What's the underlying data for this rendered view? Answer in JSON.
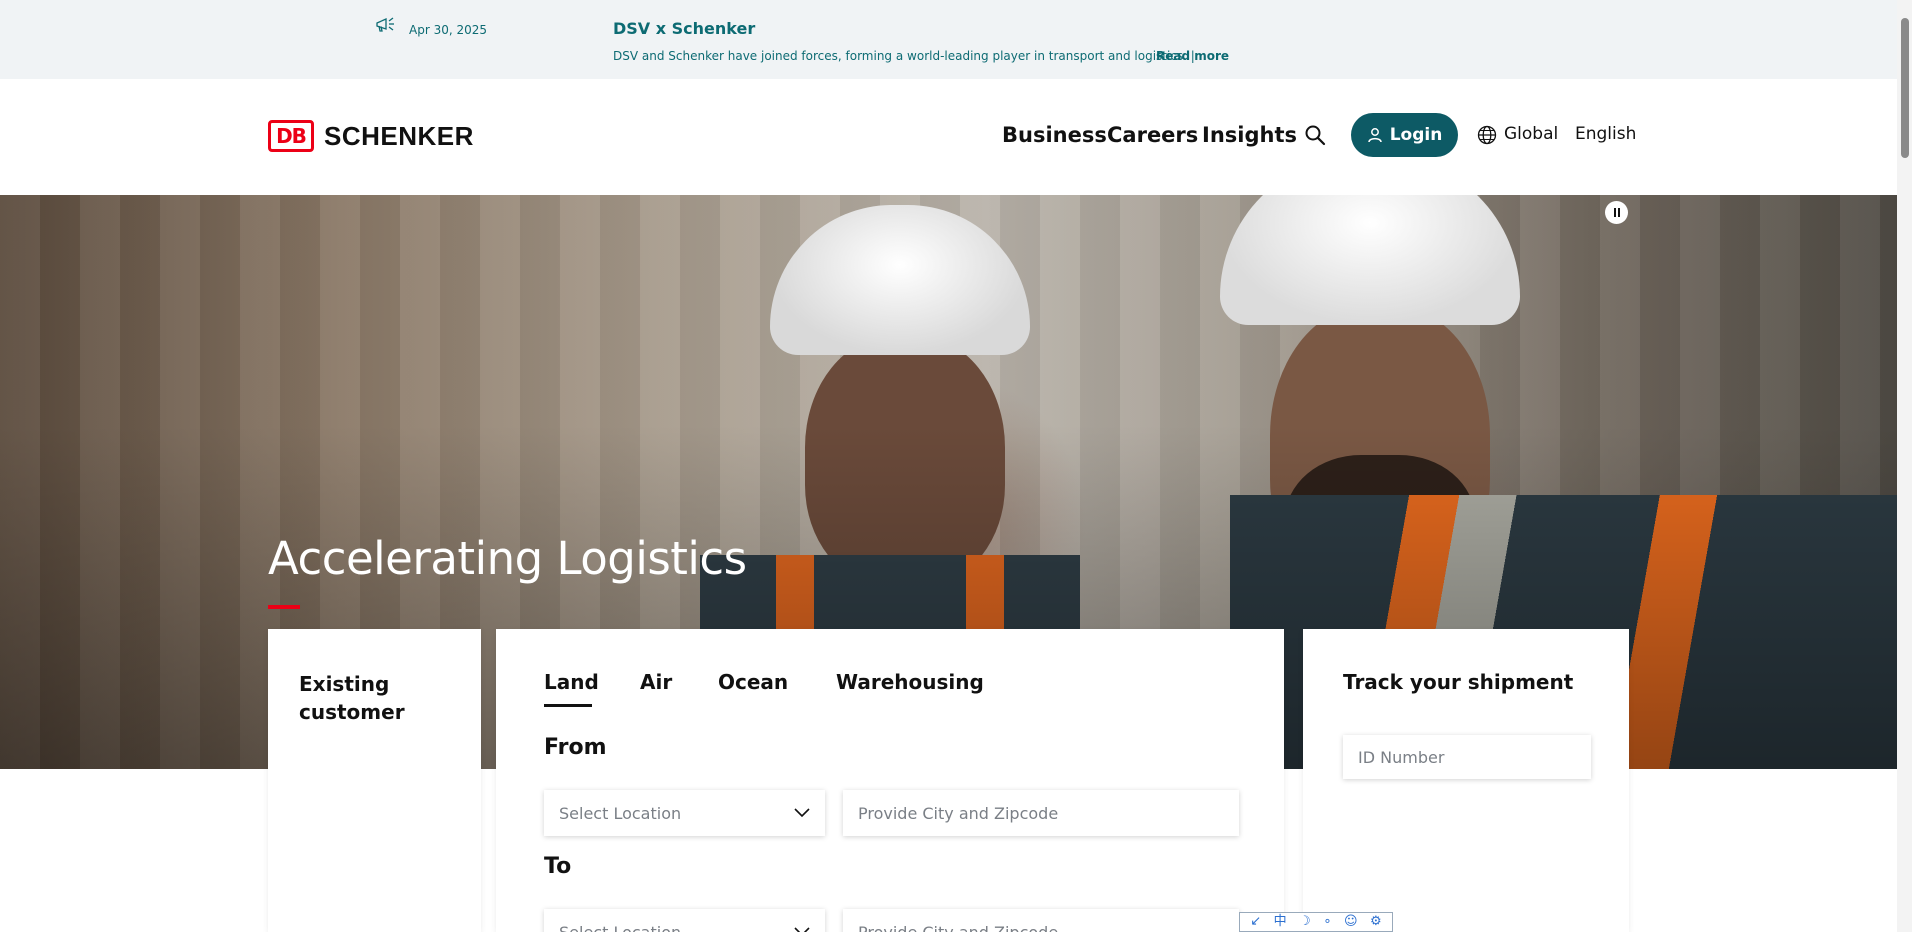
{
  "announcement": {
    "date": "Apr 30, 2025",
    "headline": "DSV x Schenker",
    "description": "DSV and Schenker have joined forces, forming a world-leading player in transport and logistics. |",
    "read_more": "Read more",
    "icon": "megaphone-icon"
  },
  "header": {
    "logo_db": "DB",
    "logo_brand": "SCHENKER",
    "nav": [
      "Business",
      "Careers",
      "Insights"
    ],
    "login_label": "Login",
    "region": "Global",
    "language": "English"
  },
  "hero": {
    "title": "Accelerating Logistics"
  },
  "existing_customer": {
    "title": "Existing customer"
  },
  "quote": {
    "tabs": [
      "Land",
      "Air",
      "Ocean",
      "Warehousing"
    ],
    "active_tab": "Land",
    "from_label": "From",
    "to_label": "To",
    "select_placeholder": "Select Location",
    "city_placeholder": "Provide City and Zipcode"
  },
  "tracking": {
    "title": "Track your shipment",
    "id_placeholder": "ID Number"
  },
  "mini_toolbar": [
    "↙",
    "中",
    "☽",
    "∘",
    "☺",
    "⚙"
  ],
  "colors": {
    "brand_red": "#ec0016",
    "teal": "#0d5a65",
    "announce_text": "#0d6b73"
  }
}
